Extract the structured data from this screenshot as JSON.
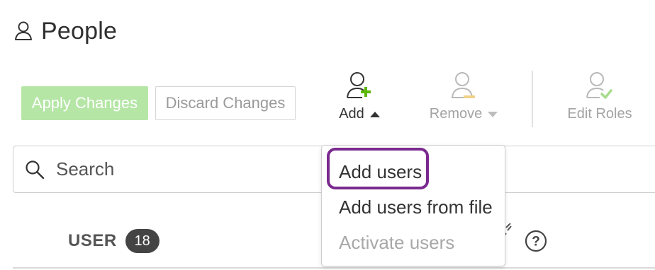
{
  "header": {
    "title": "People",
    "icon": "user-icon"
  },
  "toolbar": {
    "apply_label": "Apply Changes",
    "discard_label": "Discard Changes",
    "add_label": "Add",
    "remove_label": "Remove",
    "edit_roles_label": "Edit Roles",
    "icons": [
      "add-user-icon",
      "remove-user-icon",
      "edit-roles-icon"
    ]
  },
  "search": {
    "placeholder": "Search"
  },
  "table": {
    "user_column_label": "USER",
    "user_count": "18",
    "help_symbol": "?"
  },
  "add_menu": {
    "items": [
      {
        "label": "Add users",
        "enabled": true,
        "highlighted": true
      },
      {
        "label": "Add users from file",
        "enabled": true
      },
      {
        "label": "Activate users",
        "enabled": false
      }
    ]
  },
  "colors": {
    "apply_bg": "#b5e6a6",
    "add_accent": "#5cb800",
    "remove_accent": "#f2d28a",
    "edit_accent": "#a8dc8f",
    "highlight": "#7a2a8e"
  }
}
